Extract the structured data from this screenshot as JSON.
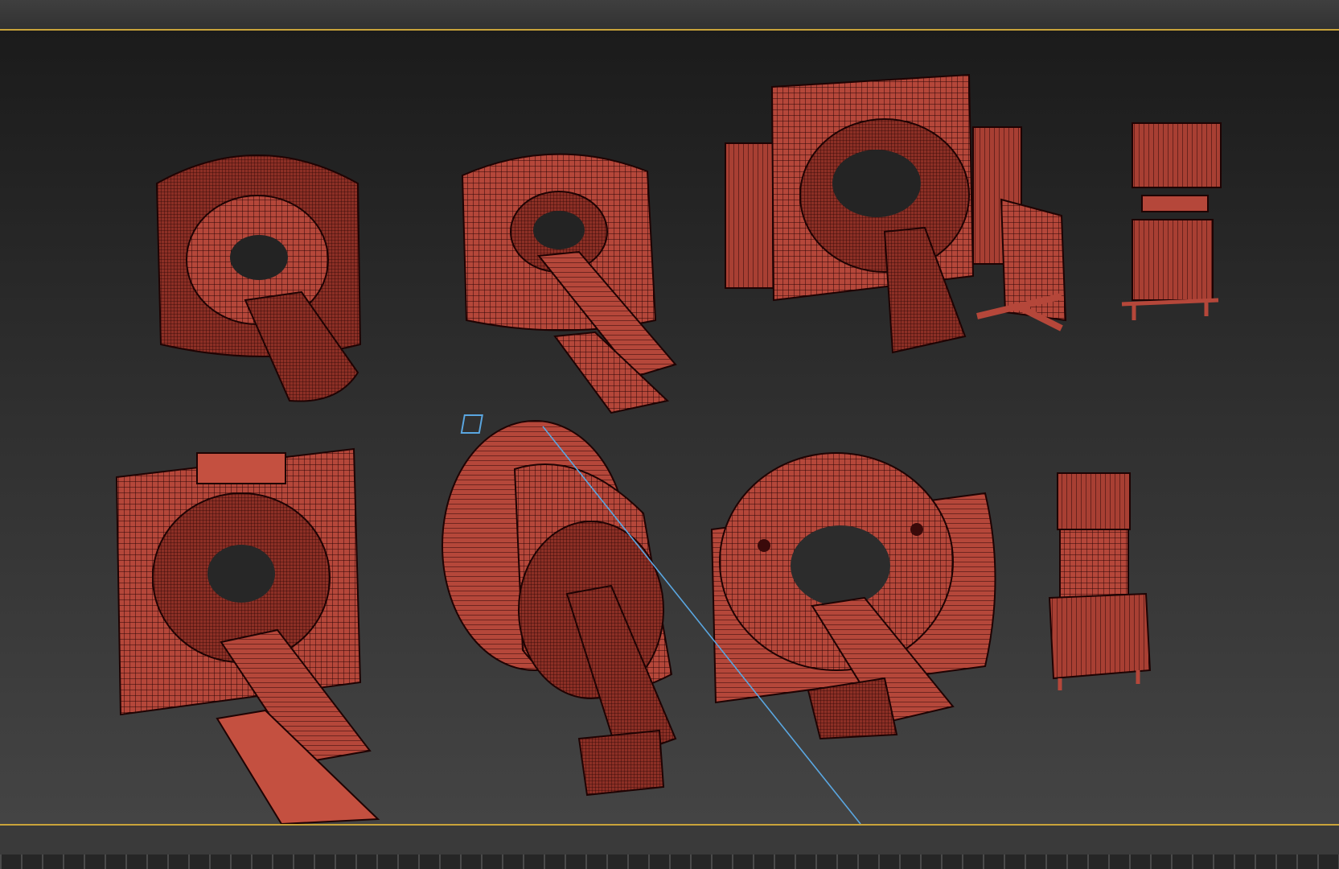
{
  "app": {
    "viewport_label": ""
  },
  "scene": {
    "mesh_color": "#b5473a",
    "mesh_dark": "#3a0a0a",
    "wire_color": "#2a0505",
    "objects": [
      "ct-scanner-1",
      "ct-scanner-2",
      "c-arm-system",
      "monitor-cart-1",
      "ct-scanner-3",
      "mri-scanner",
      "ct-scanner-4",
      "monitor-cart-2"
    ]
  },
  "colors": {
    "viewport_border": "#c9a33a",
    "camera_line": "#5aa6e0"
  }
}
